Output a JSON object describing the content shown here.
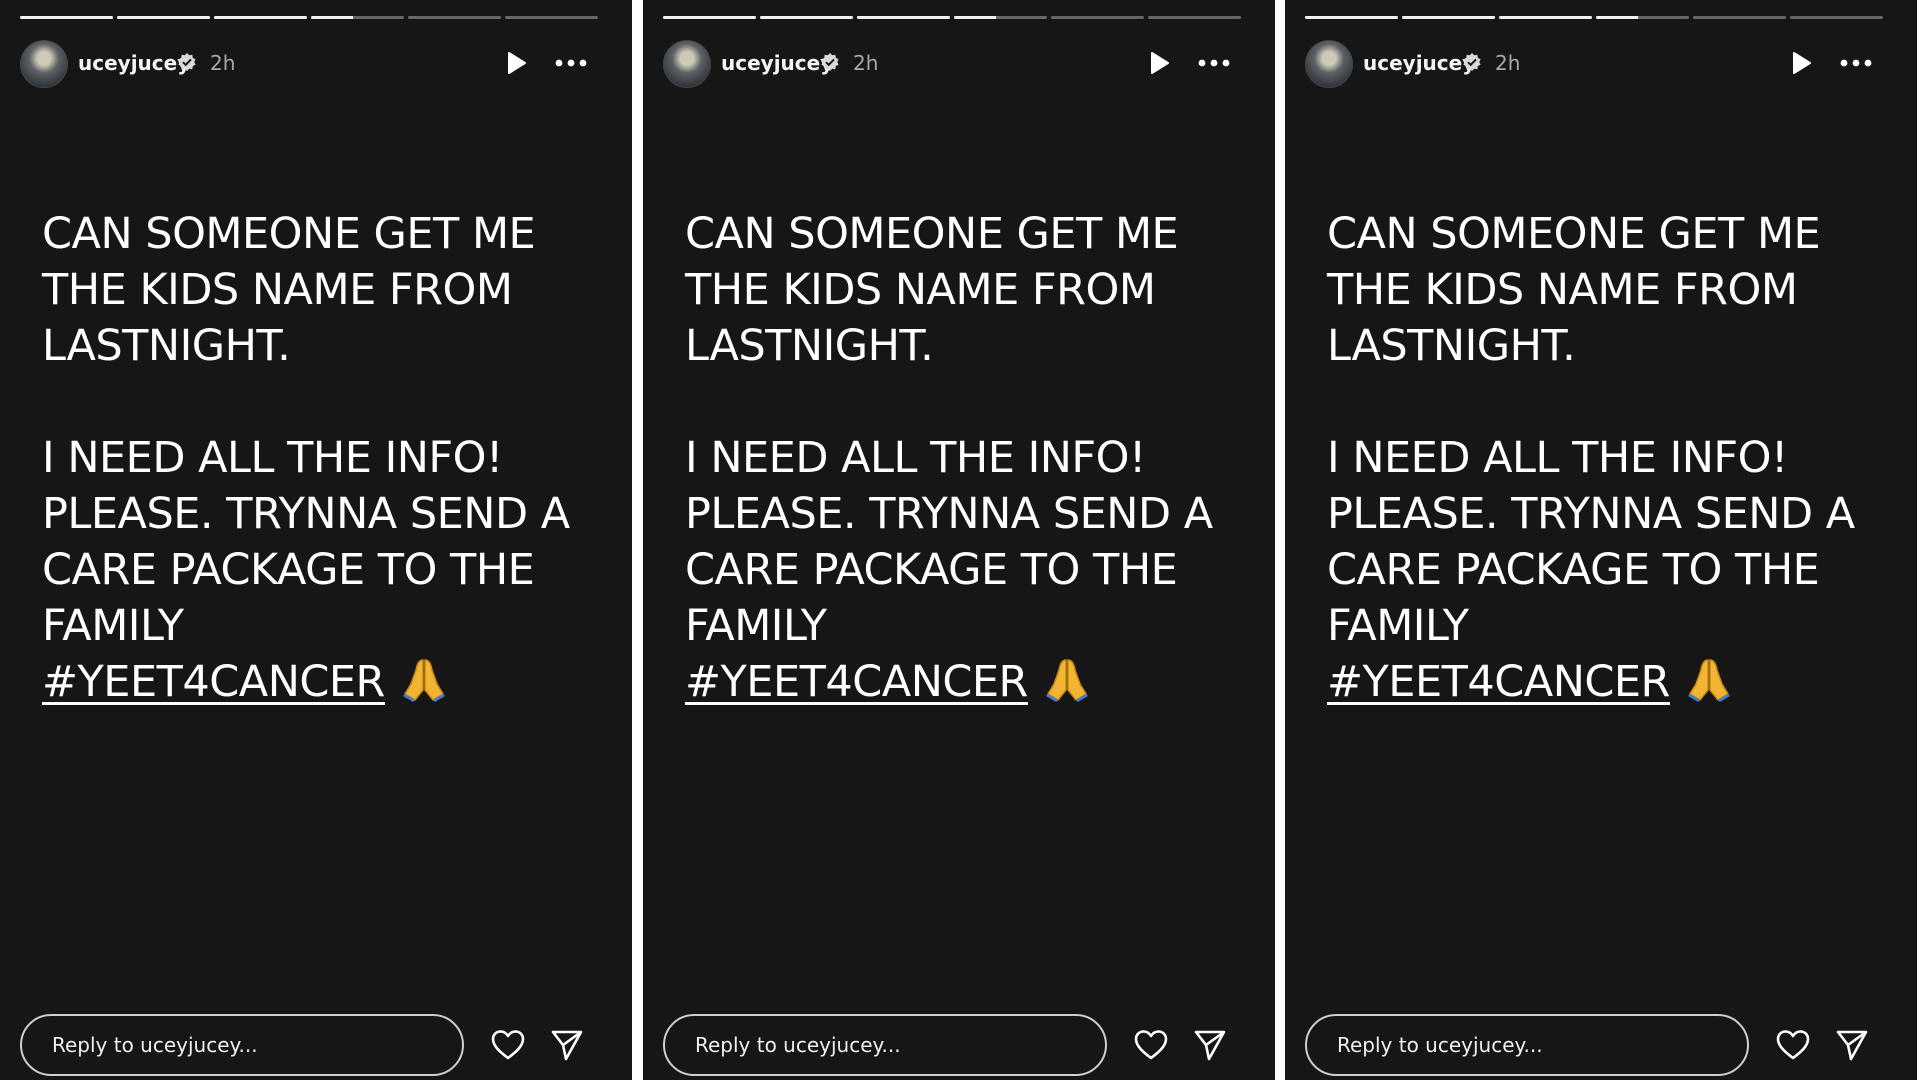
{
  "panels": [
    {
      "username": "uceyjucey",
      "time": "2h",
      "text_lines": [
        "CAN SOMEONE GET ME",
        "THE KIDS NAME FROM",
        "LASTNIGHT."
      ],
      "text_lines_2": [
        "I NEED ALL THE INFO!",
        "PLEASE. TRYNNA SEND A",
        "CARE PACKAGE TO THE",
        "FAMILY"
      ],
      "hashtag": "#YEET4CANCER",
      "reply_placeholder": "Reply to uceyjucey..."
    },
    {
      "username": "uceyjucey",
      "time": "2h",
      "text_lines": [
        "CAN SOMEONE GET ME",
        "THE KIDS NAME FROM",
        "LASTNIGHT."
      ],
      "text_lines_2": [
        "I NEED ALL THE INFO!",
        "PLEASE. TRYNNA SEND A",
        "CARE PACKAGE TO THE",
        "FAMILY"
      ],
      "hashtag": "#YEET4CANCER",
      "reply_placeholder": "Reply to uceyjucey..."
    },
    {
      "username": "uceyjucey",
      "time": "2h",
      "text_lines": [
        "CAN SOMEONE GET ME",
        "THE KIDS NAME FROM",
        "LASTNIGHT."
      ],
      "text_lines_2": [
        "I NEED ALL THE INFO!",
        "PLEASE. TRYNNA SEND A",
        "CARE PACKAGE TO THE",
        "FAMILY"
      ],
      "hashtag": "#YEET4CANCER",
      "reply_placeholder": "Reply to uceyjucey..."
    }
  ],
  "story_progress": {
    "segment_count": 6,
    "completed_segments": 3,
    "current_segment_fraction": 0.45
  },
  "icons": {
    "verified": "verified-badge-icon",
    "play": "play-icon",
    "more": "more-options-icon",
    "like": "heart-icon",
    "share": "send-icon",
    "emoji": "folded-hands-emoji"
  },
  "colors": {
    "background": "#161616",
    "text": "#ffffff",
    "muted": "#a8a8a8",
    "emoji": "#f2b533"
  }
}
